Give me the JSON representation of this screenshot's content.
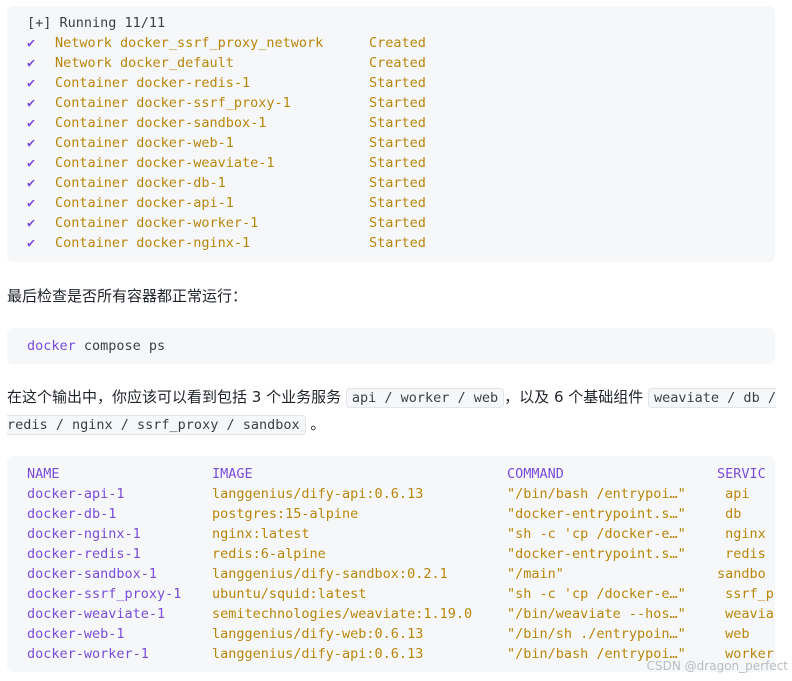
{
  "output_block": {
    "header": "[+] Running 11/11",
    "check_glyph": "✔",
    "items": [
      {
        "kind": "Network",
        "name": "docker_ssrf_proxy_network",
        "status": "Created"
      },
      {
        "kind": "Network",
        "name": "docker_default",
        "status": "Created"
      },
      {
        "kind": "Container",
        "name": "docker-redis-1",
        "status": "Started"
      },
      {
        "kind": "Container",
        "name": "docker-ssrf_proxy-1",
        "status": "Started"
      },
      {
        "kind": "Container",
        "name": "docker-sandbox-1",
        "status": "Started"
      },
      {
        "kind": "Container",
        "name": "docker-web-1",
        "status": "Started"
      },
      {
        "kind": "Container",
        "name": "docker-weaviate-1",
        "status": "Started"
      },
      {
        "kind": "Container",
        "name": "docker-db-1",
        "status": "Started"
      },
      {
        "kind": "Container",
        "name": "docker-api-1",
        "status": "Started"
      },
      {
        "kind": "Container",
        "name": "docker-worker-1",
        "status": "Started"
      },
      {
        "kind": "Container",
        "name": "docker-nginx-1",
        "status": "Started"
      }
    ]
  },
  "para1": "最后检查是否所有容器都正常运行：",
  "command": {
    "word": "docker",
    "rest": " compose ps"
  },
  "para2": {
    "part1": "在这个输出中，你应该可以看到包括 3 个业务服务 ",
    "code1": "api / worker / web",
    "part2": "，以及 6 个基础组件 ",
    "code2": "weaviate / db / redis / nginx / ssrf_proxy / sandbox",
    "part3": " 。"
  },
  "table": {
    "headers": [
      "NAME",
      "IMAGE",
      "COMMAND",
      "SERVIC"
    ],
    "rows": [
      [
        "docker-api-1",
        "langgenius/dify-api:0.6.13",
        "\"/bin/bash /entrypoi…\"",
        " api"
      ],
      [
        "docker-db-1",
        "postgres:15-alpine",
        "\"docker-entrypoint.s…\"",
        " db"
      ],
      [
        "docker-nginx-1",
        "nginx:latest",
        "\"sh -c 'cp /docker-e…\"",
        " nginx"
      ],
      [
        "docker-redis-1",
        "redis:6-alpine",
        "\"docker-entrypoint.s…\"",
        " redis"
      ],
      [
        "docker-sandbox-1",
        "langgenius/dify-sandbox:0.2.1",
        "\"/main\"",
        "sandbo"
      ],
      [
        "docker-ssrf_proxy-1",
        "ubuntu/squid:latest",
        "\"sh -c 'cp /docker-e…\"",
        " ssrf_pr"
      ],
      [
        "docker-weaviate-1",
        "semitechnologies/weaviate:1.19.0",
        "\"/bin/weaviate --hos…\"",
        " weaviat"
      ],
      [
        "docker-web-1",
        "langgenius/dify-web:0.6.13",
        "\"/bin/sh ./entrypoin…\"",
        " web"
      ],
      [
        "docker-worker-1",
        "langgenius/dify-api:0.6.13",
        "\"/bin/bash /entrypoi…\"",
        " worker"
      ]
    ]
  },
  "watermark": "CSDN @dragon_perfect"
}
